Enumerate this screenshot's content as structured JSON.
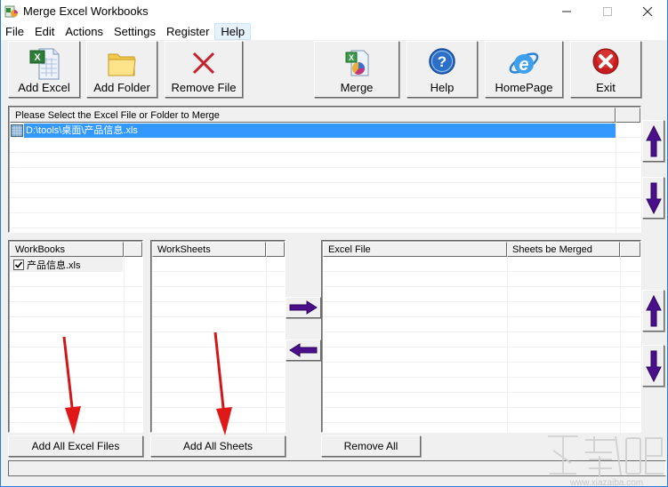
{
  "window": {
    "title": "Merge Excel Workbooks",
    "controls": {
      "minimize": "—",
      "maximize": "☐",
      "close": "✕"
    }
  },
  "menu": [
    {
      "label": "File"
    },
    {
      "label": "Edit"
    },
    {
      "label": "Actions"
    },
    {
      "label": "Settings"
    },
    {
      "label": "Register"
    },
    {
      "label": "Help",
      "highlighted": true
    }
  ],
  "toolbar": {
    "add_excel": {
      "label": "Add Excel",
      "icon": "excel-file-icon"
    },
    "add_folder": {
      "label": "Add Folder",
      "icon": "folder-icon"
    },
    "remove_file": {
      "label": "Remove File",
      "icon": "red-x-icon"
    },
    "merge": {
      "label": "Merge",
      "icon": "merge-icon"
    },
    "help": {
      "label": "Help",
      "icon": "help-icon"
    },
    "homepage": {
      "label": "HomePage",
      "icon": "internet-explorer-icon"
    },
    "exit": {
      "label": "Exit",
      "icon": "exit-icon"
    }
  },
  "file_list": {
    "header": "Please Select the Excel File or Folder to Merge",
    "items": [
      {
        "path": "D:\\tools\\桌面\\产品信息.xls",
        "selected": true
      }
    ]
  },
  "workbooks": {
    "header": "WorkBooks",
    "items": [
      {
        "name": "产品信息.xls",
        "checked": true
      }
    ]
  },
  "worksheets": {
    "header": "WorkSheets",
    "items": []
  },
  "merge_list": {
    "columns": [
      "Excel File",
      "Sheets be Merged"
    ],
    "rows": []
  },
  "buttons": {
    "add_all_excel_files": "Add All Excel Files",
    "add_all_sheets": "Add All Sheets",
    "remove_all": "Remove All"
  },
  "colors": {
    "selection": "#3399ff",
    "arrow_purple": "#4b0f8c",
    "annotation_red": "#e01818"
  },
  "watermark": {
    "text": "下载吧",
    "url_text": "www.xiazaiba.com"
  }
}
